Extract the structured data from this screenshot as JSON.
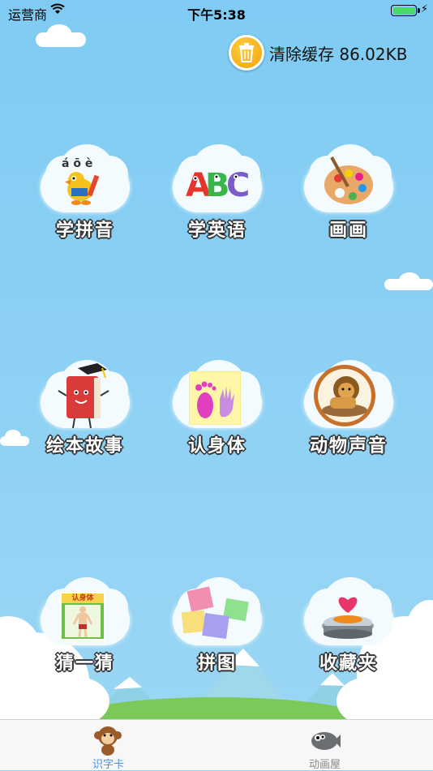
{
  "status_bar": {
    "carrier": "运营商",
    "time": "下午5:38",
    "wifi_icon": "wifi-icon",
    "battery_icon": "battery-icon"
  },
  "cache": {
    "label": "清除缓存 86.02KB",
    "icon": "trash-icon",
    "color": "#f0a10c"
  },
  "grid": {
    "items": [
      {
        "label": "学拼音",
        "icon": "pinyin-bird-icon"
      },
      {
        "label": "学英语",
        "icon": "abc-letters-icon"
      },
      {
        "label": "画画",
        "icon": "paint-palette-icon"
      },
      {
        "label": "绘本故事",
        "icon": "storybook-icon"
      },
      {
        "label": "认身体",
        "icon": "footprint-hand-icon"
      },
      {
        "label": "动物声音",
        "icon": "lion-icon"
      },
      {
        "label": "猜一猜",
        "icon": "body-chart-icon"
      },
      {
        "label": "拼图",
        "icon": "puzzle-icon"
      },
      {
        "label": "收藏夹",
        "icon": "heart-box-icon"
      }
    ],
    "card_text": "认身体"
  },
  "tabbar": {
    "tabs": [
      {
        "label": "识字卡",
        "icon": "monkey-icon",
        "active": true,
        "color": "#4a90e2"
      },
      {
        "label": "动画屋",
        "icon": "fish-icon",
        "active": false,
        "color": "#888888"
      }
    ]
  }
}
